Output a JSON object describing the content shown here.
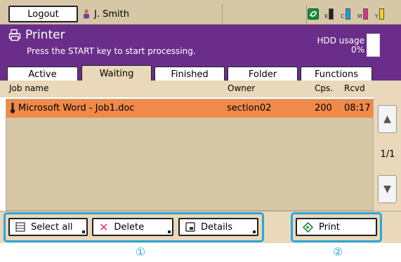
{
  "topbar": {
    "logout_label": "Logout",
    "user_name": "J. Smith",
    "inks": [
      {
        "label": "K",
        "color": "#222222"
      },
      {
        "label": "C",
        "color": "#14a0d8"
      },
      {
        "label": "M",
        "color": "#e0308a"
      },
      {
        "label": "Y",
        "color": "#f2d21a"
      }
    ]
  },
  "header": {
    "title": "Printer",
    "instruction": "Press the START key to start processing.",
    "hdd_label": "HDD usage",
    "hdd_value": "0%"
  },
  "tabs": [
    {
      "label": "Active"
    },
    {
      "label": "Waiting"
    },
    {
      "label": "Finished"
    },
    {
      "label": "Folder"
    },
    {
      "label": "Functions"
    }
  ],
  "list": {
    "columns": {
      "job_name": "Job name",
      "owner": "Owner",
      "copies": "Cps.",
      "received": "Rcvd"
    },
    "rows": [
      {
        "job_name": "Microsoft Word - Job1.doc",
        "owner": "section02",
        "copies": "200",
        "received": "08:17"
      }
    ],
    "page_indicator": "1/1"
  },
  "actions": {
    "select_all": "Select all",
    "delete": "Delete",
    "details": "Details",
    "print": "Print"
  },
  "annotations": {
    "group1": "①",
    "group2": "②"
  }
}
